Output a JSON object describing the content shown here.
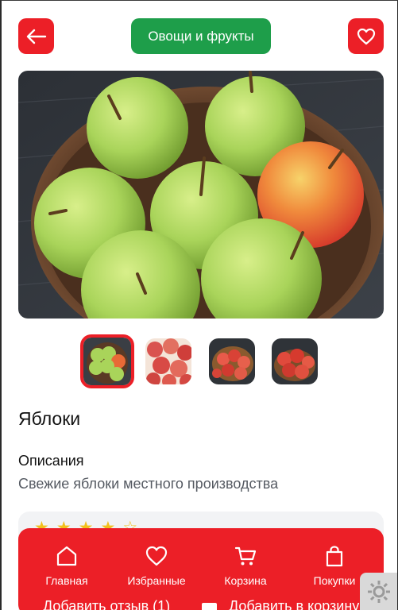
{
  "header": {
    "back_icon": "arrow-left-icon",
    "category_label": "Овощи и фрукты",
    "favorite_icon": "heart-icon"
  },
  "product": {
    "title": "Яблоки",
    "description_heading": "Описания",
    "description": "Свежие яблоки местного производства",
    "gallery_selected": 1,
    "gallery_count": 4
  },
  "reviews": {
    "rating": 4,
    "max_rating": 5,
    "add_review_label": "Добавить отзыв (1)",
    "add_to_cart_label": "Добавить в корзину"
  },
  "bottom_nav": {
    "items": [
      {
        "label": "Главная",
        "icon": "home-icon"
      },
      {
        "label": "Избранные",
        "icon": "heart-icon"
      },
      {
        "label": "Корзина",
        "icon": "cart-icon"
      },
      {
        "label": "Покупки",
        "icon": "shopping-bag-icon"
      }
    ]
  },
  "settings_icon": "gear-icon",
  "colors": {
    "accent_red": "#ec1f27",
    "category_green": "#1e9e4a",
    "star_yellow": "#f3c01c"
  }
}
